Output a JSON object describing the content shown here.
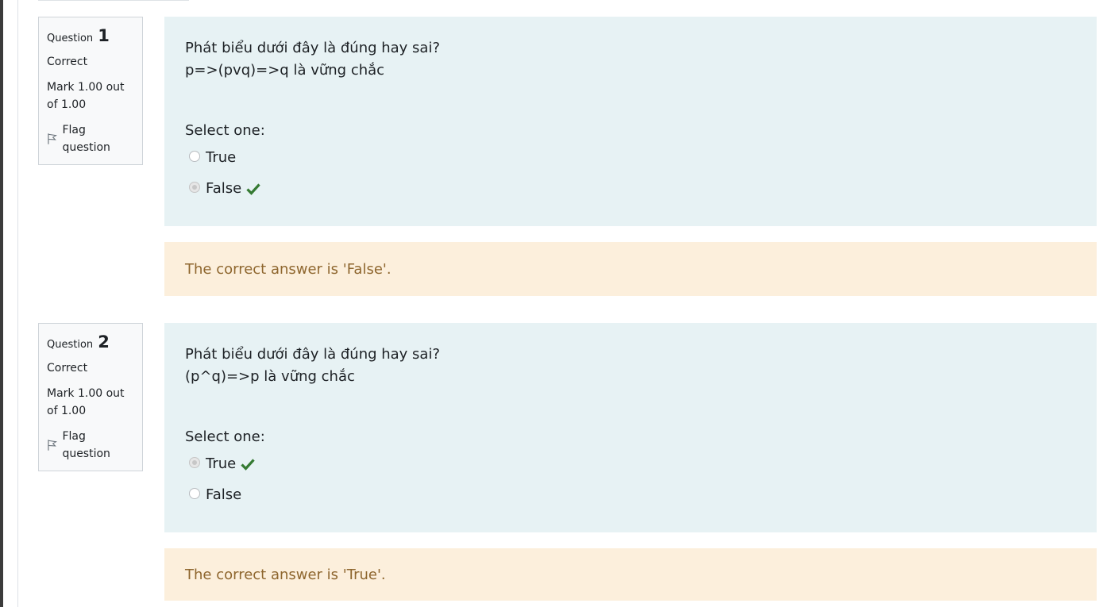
{
  "questions": [
    {
      "label": "Question",
      "number": "1",
      "state": "Correct",
      "grade": "Mark 1.00 out of 1.00",
      "flag_label": "Flag question",
      "text_line1": "Phát biểu dưới đây là đúng hay sai?",
      "text_line2": "p=>(pvq)=>q là vững chắc",
      "prompt": "Select one:",
      "options": [
        {
          "label": "True",
          "selected": false,
          "correct": false
        },
        {
          "label": "False",
          "selected": true,
          "correct": true
        }
      ],
      "right_answer": "The correct answer is 'False'."
    },
    {
      "label": "Question",
      "number": "2",
      "state": "Correct",
      "grade": "Mark 1.00 out of 1.00",
      "flag_label": "Flag question",
      "text_line1": "Phát biểu dưới đây là đúng hay sai?",
      "text_line2": "(p^q)=>p là vững chắc",
      "prompt": "Select one:",
      "options": [
        {
          "label": "True",
          "selected": true,
          "correct": true
        },
        {
          "label": "False",
          "selected": false,
          "correct": false
        }
      ],
      "right_answer": "The correct answer is 'True'."
    }
  ],
  "colors": {
    "formulation_bg": "#e7f2f4",
    "feedback_bg": "#fcefdc",
    "feedback_text": "#8e662e",
    "correct_tick": "#357a32"
  },
  "icons": {
    "flag": "flag-icon",
    "correct": "check-icon"
  }
}
